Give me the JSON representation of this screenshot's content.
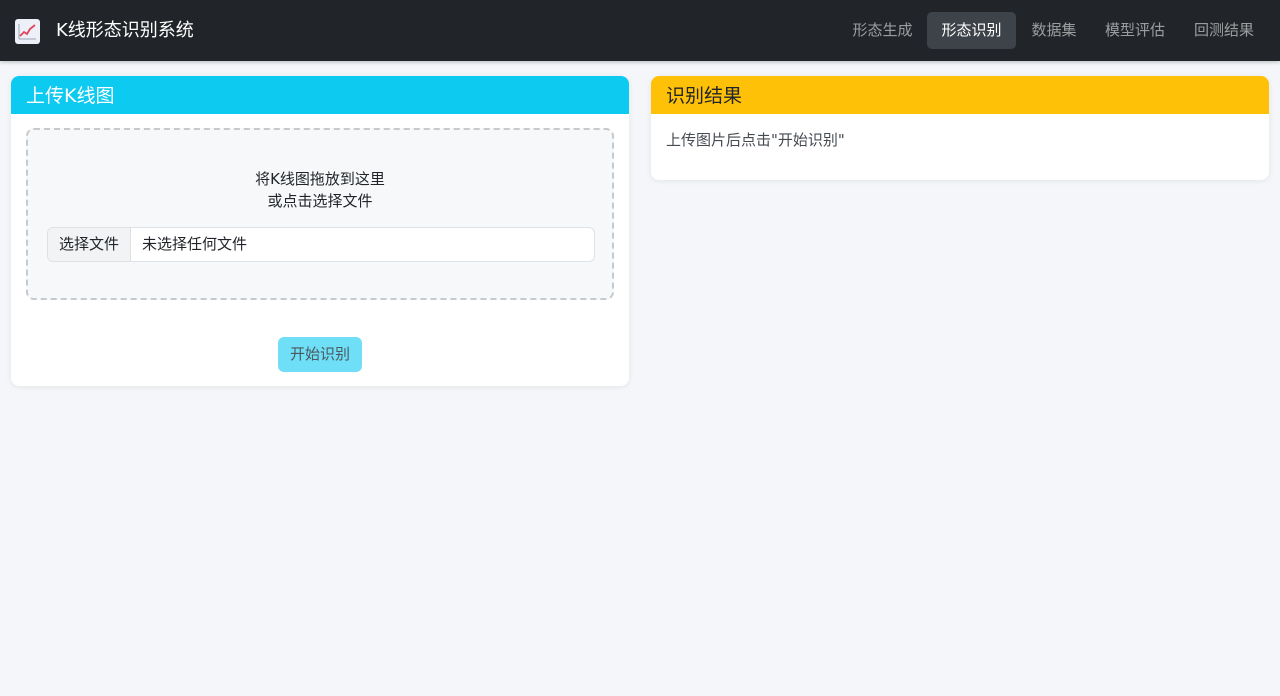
{
  "nav": {
    "brand_icon": "chart-upward-trend-icon",
    "brand_title": "K线形态识别系统",
    "items": [
      {
        "label": "形态生成",
        "active": false
      },
      {
        "label": "形态识别",
        "active": true
      },
      {
        "label": "数据集",
        "active": false
      },
      {
        "label": "模型评估",
        "active": false
      },
      {
        "label": "回测结果",
        "active": false
      }
    ]
  },
  "upload": {
    "header": "上传K线图",
    "drop_line1": "将K线图拖放到这里",
    "drop_line2": "或点击选择文件",
    "file_button": "选择文件",
    "file_status": "未选择任何文件",
    "start_button": "开始识别"
  },
  "result": {
    "header": "识别结果",
    "hint": "上传图片后点击\"开始识别\""
  },
  "colors": {
    "navbar": "#212529",
    "upload_header": "#0dcaf0",
    "result_header": "#ffc107",
    "start_button": "#6edff6",
    "page_background": "#f4f6f9"
  }
}
